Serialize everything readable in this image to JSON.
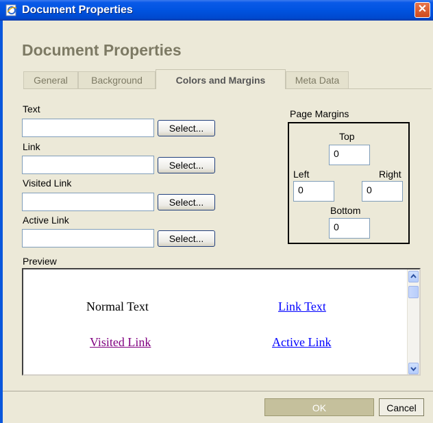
{
  "window": {
    "title": "Document Properties",
    "close_glyph": "✕"
  },
  "heading": "Document Properties",
  "tabs": [
    {
      "label": "General"
    },
    {
      "label": "Background"
    },
    {
      "label": "Colors and Margins",
      "active": true
    },
    {
      "label": "Meta Data"
    }
  ],
  "colors": {
    "text_label": "Text",
    "link_label": "Link",
    "visited_label": "Visited Link",
    "active_label": "Active Link",
    "text_value": "",
    "link_value": "",
    "visited_value": "",
    "active_value": "",
    "select_label": "Select..."
  },
  "margins": {
    "group_label": "Page Margins",
    "top_label": "Top",
    "left_label": "Left",
    "right_label": "Right",
    "bottom_label": "Bottom",
    "top": "0",
    "left": "0",
    "right": "0",
    "bottom": "0"
  },
  "preview": {
    "label": "Preview",
    "normal_text": "Normal Text",
    "link_text": "Link Text",
    "visited_link": "Visited Link",
    "active_link": "Active Link"
  },
  "footer": {
    "ok": "OK",
    "cancel": "Cancel"
  },
  "palette": {
    "link": "#0000ff",
    "visited": "#800080",
    "title_bar": "#0053e0",
    "close": "#d04a1c"
  }
}
